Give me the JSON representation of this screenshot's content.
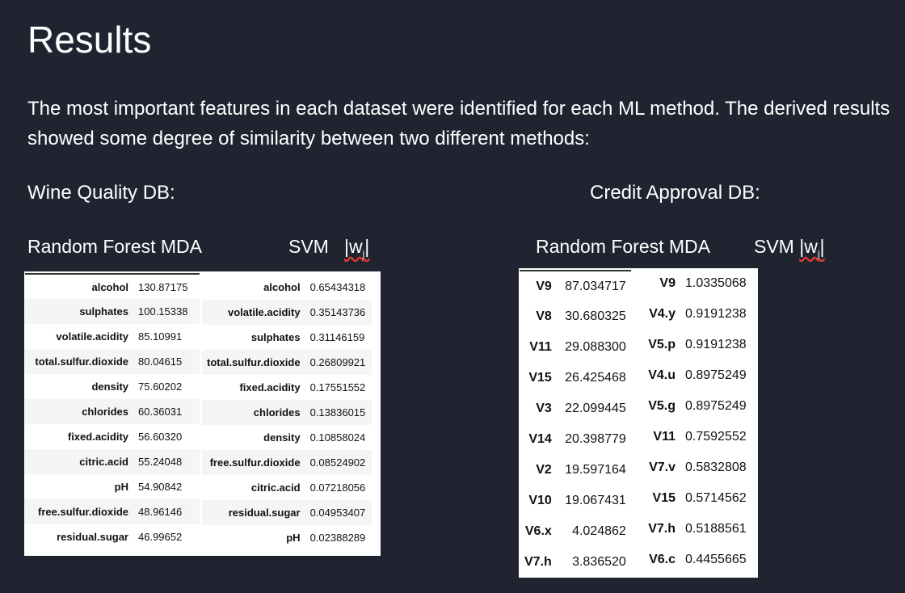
{
  "title": "Results",
  "intro": "The most important features in each dataset were identified for each ML method. The derived results showed some degree of similarity between two different methods:",
  "wine": {
    "label": "Wine Quality DB:",
    "rf_label": "Random Forest MDA",
    "svm_label": "SVM",
    "svm_w_open": "|w",
    "svm_w_sub": "j",
    "svm_w_close": "|",
    "rf_rows": [
      {
        "feature": "alcohol",
        "value": "130.87175"
      },
      {
        "feature": "sulphates",
        "value": "100.15338"
      },
      {
        "feature": "volatile.acidity",
        "value": "85.10991"
      },
      {
        "feature": "total.sulfur.dioxide",
        "value": "80.04615"
      },
      {
        "feature": "density",
        "value": "75.60202"
      },
      {
        "feature": "chlorides",
        "value": "60.36031"
      },
      {
        "feature": "fixed.acidity",
        "value": "56.60320"
      },
      {
        "feature": "citric.acid",
        "value": "55.24048"
      },
      {
        "feature": "pH",
        "value": "54.90842"
      },
      {
        "feature": "free.sulfur.dioxide",
        "value": "48.96146"
      },
      {
        "feature": "residual.sugar",
        "value": "46.99652"
      }
    ],
    "svm_rows": [
      {
        "feature": "alcohol",
        "value": "0.65434318"
      },
      {
        "feature": "volatile.acidity",
        "value": "0.35143736"
      },
      {
        "feature": "sulphates",
        "value": "0.31146159"
      },
      {
        "feature": "total.sulfur.dioxide",
        "value": "0.26809921"
      },
      {
        "feature": "fixed.acidity",
        "value": "0.17551552"
      },
      {
        "feature": "chlorides",
        "value": "0.13836015"
      },
      {
        "feature": "density",
        "value": "0.10858024"
      },
      {
        "feature": "free.sulfur.dioxide",
        "value": "0.08524902"
      },
      {
        "feature": "citric.acid",
        "value": "0.07218056"
      },
      {
        "feature": "residual.sugar",
        "value": "0.04953407"
      },
      {
        "feature": "pH",
        "value": "0.02388289"
      }
    ]
  },
  "credit": {
    "label": "Credit Approval DB:",
    "rf_label": "Random Forest MDA",
    "svm_label": "SVM",
    "svm_w_open": "|w",
    "svm_w_sub": "j",
    "svm_w_close": "|",
    "rf_rows": [
      {
        "feature": "V9",
        "value": "87.034717"
      },
      {
        "feature": "V8",
        "value": "30.680325"
      },
      {
        "feature": "V11",
        "value": "29.088300"
      },
      {
        "feature": "V15",
        "value": "26.425468"
      },
      {
        "feature": "V3",
        "value": "22.099445"
      },
      {
        "feature": "V14",
        "value": "20.398779"
      },
      {
        "feature": "V2",
        "value": "19.597164"
      },
      {
        "feature": "V10",
        "value": "19.067431"
      },
      {
        "feature": "V6.x",
        "value": "4.024862"
      },
      {
        "feature": "V7.h",
        "value": "3.836520"
      }
    ],
    "svm_rows": [
      {
        "feature": "V9",
        "value": "1.0335068"
      },
      {
        "feature": "V4.y",
        "value": "0.9191238"
      },
      {
        "feature": "V5.p",
        "value": "0.9191238"
      },
      {
        "feature": "V4.u",
        "value": "0.8975249"
      },
      {
        "feature": "V5.g",
        "value": "0.8975249"
      },
      {
        "feature": "V11",
        "value": "0.7592552"
      },
      {
        "feature": "V7.v",
        "value": "0.5832808"
      },
      {
        "feature": "V15",
        "value": "0.5714562"
      },
      {
        "feature": "V7.h",
        "value": "0.5188561"
      },
      {
        "feature": "V6.c",
        "value": "0.4455665"
      }
    ]
  }
}
